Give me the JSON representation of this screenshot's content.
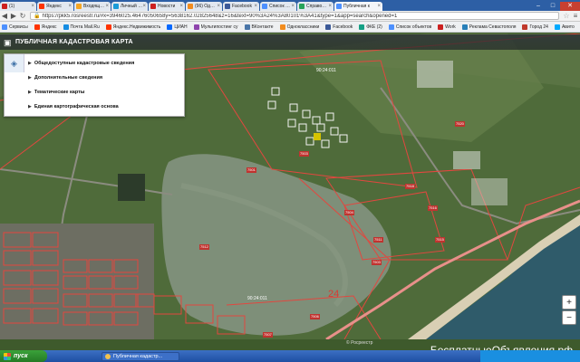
{
  "browser": {
    "tabs": [
      {
        "label": "(1)",
        "color": "#cc2020",
        "active": false
      },
      {
        "label": "Яндекс",
        "color": "#ff3300",
        "active": false
      },
      {
        "label": "Входящие —",
        "color": "#f5a623",
        "active": false
      },
      {
        "label": "Личный кабин",
        "color": "#1a9bd8",
        "active": false
      },
      {
        "label": "Новости",
        "color": "#cc2020",
        "active": false
      },
      {
        "label": "(96) Одноклас",
        "color": "#f28c1e",
        "active": false
      },
      {
        "label": "Facebook",
        "color": "#3b5998",
        "active": false
      },
      {
        "label": "Список объект",
        "color": "#4d90fe",
        "active": false
      },
      {
        "label": "Справочная",
        "color": "#27a35a",
        "active": false
      },
      {
        "label": "Публичная к",
        "color": "#4d90fe",
        "active": true
      }
    ],
    "window_controls": [
      "–",
      "□",
      "✕"
    ],
    "url": "https://pkk5.rosreestr.ru/#x=3946025.46476050658y=5638162.02825648&z=16&text=90%3A24%3A80101%3A41&type=1&app=search&opened=1",
    "bookmarks": [
      {
        "label": "Сервисы",
        "color": "#4d90fe"
      },
      {
        "label": "Яндекс",
        "color": "#ff3300"
      },
      {
        "label": "Почта Mail.Ru",
        "color": "#168de2"
      },
      {
        "label": "Яндекс.Недвижимость",
        "color": "#ff3300"
      },
      {
        "label": "ЦИАН",
        "color": "#0468ff"
      },
      {
        "label": "Мультипостинг су",
        "color": "#8e44ad"
      },
      {
        "label": "ВКонтакте",
        "color": "#4a76a8"
      },
      {
        "label": "Одноклассники",
        "color": "#f28c1e"
      },
      {
        "label": "Facebook",
        "color": "#3b5998"
      },
      {
        "label": "ФКЕ (2)",
        "color": "#16a085"
      },
      {
        "label": "Список объектов",
        "color": "#4d90fe"
      },
      {
        "label": "Work",
        "color": "#cc2020"
      },
      {
        "label": "Реклама Севастополя",
        "color": "#2980b9"
      },
      {
        "label": "Город 24",
        "color": "#c0392b"
      },
      {
        "label": "Авито",
        "color": "#00aaff"
      }
    ]
  },
  "app": {
    "title": "ПУБЛИЧНАЯ КАДАСТРОВАЯ КАРТА",
    "panel_items": [
      "Общедоступные кадастровые сведения",
      "Дополнительные сведения",
      "Тематические карты",
      "Единая картографическая основа"
    ],
    "zoom_in": "+",
    "zoom_out": "−",
    "map_labels": [
      "24",
      "90:24:011",
      "7503",
      "7518",
      "7516",
      "7504",
      "7503",
      "7512",
      "7520",
      "7506",
      "7511",
      "7515",
      "7501",
      "7507"
    ],
    "copyright": "© Росреестр"
  },
  "watermark": "БесплатныеОбъявления.рф",
  "taskbar": {
    "start_label": "пуск",
    "task_label": "Публичная кадастр..."
  }
}
